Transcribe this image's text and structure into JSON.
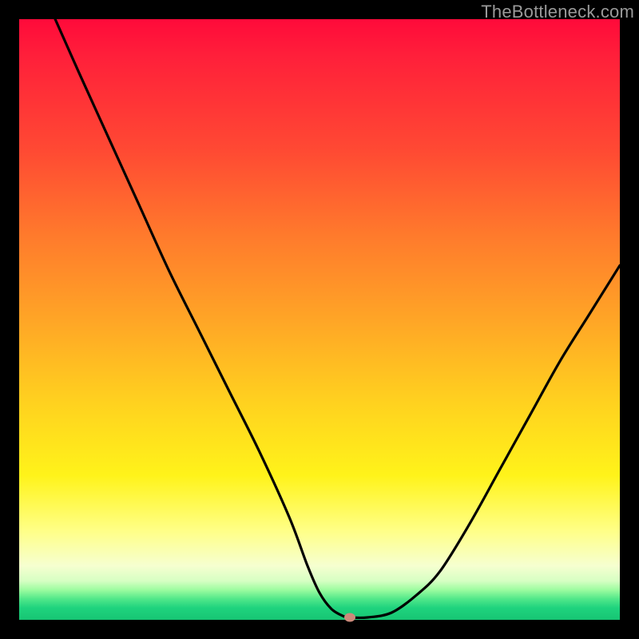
{
  "watermark": "TheBottleneck.com",
  "colors": {
    "background": "#000000",
    "curve": "#000000",
    "marker": "#cd8a7b",
    "gradient_top": "#ff0a3a",
    "gradient_bottom": "#17c573"
  },
  "chart_data": {
    "type": "line",
    "title": "",
    "xlabel": "",
    "ylabel": "",
    "xlim": [
      0,
      100
    ],
    "ylim": [
      0,
      100
    ],
    "grid": false,
    "legend": false,
    "series": [
      {
        "name": "bottleneck-curve",
        "x": [
          6,
          10,
          15,
          20,
          25,
          30,
          35,
          40,
          45,
          48,
          50,
          52,
          54,
          55,
          58,
          62,
          66,
          70,
          75,
          80,
          85,
          90,
          95,
          100
        ],
        "y": [
          100,
          91,
          80,
          69,
          58,
          48,
          38,
          28,
          17,
          9,
          4.5,
          1.8,
          0.6,
          0.4,
          0.4,
          1.2,
          4,
          8,
          16,
          25,
          34,
          43,
          51,
          59
        ]
      }
    ],
    "marker": {
      "x": 55,
      "y": 0.4
    },
    "flat_segment": {
      "x_start": 52,
      "x_end": 58,
      "y": 0.4
    }
  }
}
